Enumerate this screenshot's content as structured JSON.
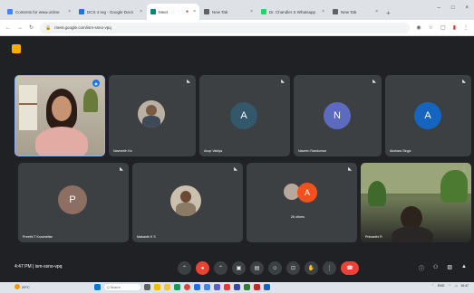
{
  "browser": {
    "tabs": [
      {
        "title": "Contents for www.online",
        "favicon_color": "#4285f4",
        "active": false
      },
      {
        "title": "DCS 4 reg - Google Docs",
        "favicon_color": "#1a73e8",
        "active": false
      },
      {
        "title": "Meet",
        "favicon_color": "#00897b",
        "active": true
      },
      {
        "title": "New Tab",
        "favicon_color": "#5f6368",
        "active": false
      },
      {
        "title": "Dr. Chandler S Whatsapp",
        "favicon_color": "#25d366",
        "active": false
      },
      {
        "title": "New Tab",
        "favicon_color": "#5f6368",
        "active": false
      }
    ],
    "url": "meet.google.com/ism-ssno-vpq"
  },
  "tiles": [
    {
      "id": "self",
      "name": "",
      "type": "video"
    },
    {
      "id": "navneeth",
      "name": "Navneeth Ks",
      "type": "photo"
    },
    {
      "id": "anup",
      "name": "Anup Vaidya",
      "type": "letter",
      "letter": "A",
      "color": "#33576b"
    },
    {
      "id": "naveen",
      "name": "Naveen Ramkumar",
      "type": "letter",
      "letter": "N",
      "color": "#5c6bc0"
    },
    {
      "id": "akshara",
      "name": "Akshara Singa",
      "type": "letter",
      "letter": "A",
      "color": "#1565c0"
    },
    {
      "id": "preethi",
      "name": "Preethi T Kunchettar",
      "type": "letter",
      "letter": "P",
      "color": "#8d6e63"
    },
    {
      "id": "mahanth",
      "name": "Mahanth K S",
      "type": "photo"
    },
    {
      "id": "others",
      "name": "26 others",
      "type": "group",
      "letter": "A",
      "color": "#f4511e"
    },
    {
      "id": "presenter",
      "name": "Primanthi R",
      "type": "video"
    }
  ],
  "bottombar": {
    "meeting_info": "4:47 PM  |  ism-ssno-vpq"
  },
  "taskbar": {
    "weather": "29°C",
    "search": "Q Search",
    "lang": "ENG",
    "clock": "16:47"
  }
}
